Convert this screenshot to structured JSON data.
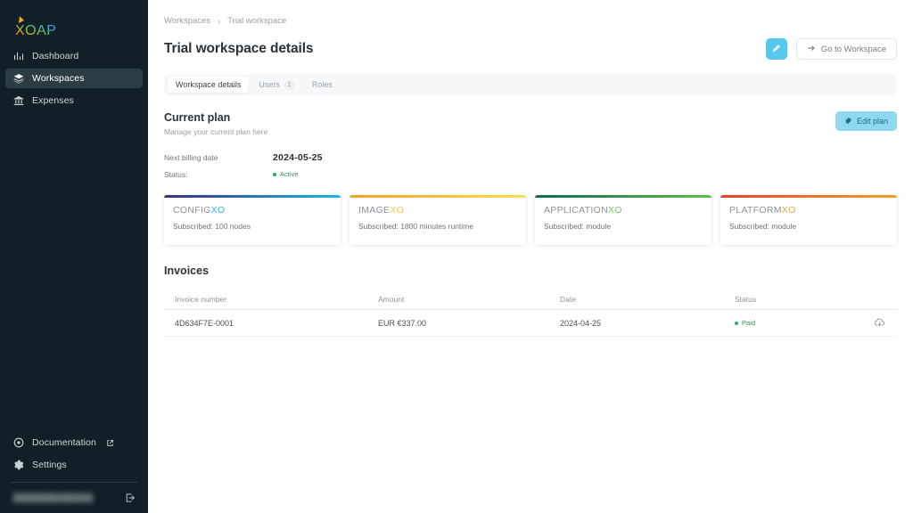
{
  "brand": {
    "name": "XOAP"
  },
  "sidebar": {
    "items": [
      {
        "label": "Dashboard",
        "icon": "chart-bar-icon",
        "active": false
      },
      {
        "label": "Workspaces",
        "icon": "layers-icon",
        "active": true
      },
      {
        "label": "Expenses",
        "icon": "bank-icon",
        "active": false
      }
    ],
    "bottom": [
      {
        "label": "Documentation",
        "icon": "info-circle-icon",
        "external": true
      },
      {
        "label": "Settings",
        "icon": "gear-icon",
        "external": false
      }
    ],
    "user_email": "redacted@email.com",
    "logout_icon": "logout-icon"
  },
  "breadcrumb": {
    "root": "Workspaces",
    "separator": "›",
    "current": "Trial workspace"
  },
  "header": {
    "title": "Trial workspace details",
    "edit_icon": "pencil-icon",
    "go_to_workspace_label": "Go to Workspace",
    "go_to_workspace_icon": "arrow-right-icon"
  },
  "tabs": [
    {
      "label": "Workspace details",
      "badge": "",
      "active": true
    },
    {
      "label": "Users",
      "badge": "1",
      "active": false
    },
    {
      "label": "Roles",
      "badge": "",
      "active": false
    }
  ],
  "current_plan": {
    "title": "Current plan",
    "subtitle": "Manage your current plan here",
    "edit_button_label": "Edit plan",
    "edit_button_icon": "gear-icon",
    "next_billing_label": "Next billing date",
    "next_billing_value": "2024-05-25",
    "status_label": "Status:",
    "status_value": "Active",
    "status_color": "#27ae60"
  },
  "products": [
    {
      "name_main": "CONFIG",
      "name_suffix": "XO",
      "subscribed": "Subscribed: 100 nodes",
      "bar_from": "#3b2f87",
      "bar_to": "#18b6e9",
      "suffix_color": "#2fb4e0"
    },
    {
      "name_main": "IMAGE",
      "name_suffix": "XO",
      "subscribed": "Subscribed: 1800 minutes runtime",
      "bar_from": "#f4a02a",
      "bar_to": "#f5de52",
      "suffix_color": "#f2c948"
    },
    {
      "name_main": "APPLICATION",
      "name_suffix": "XO",
      "subscribed": "Subscribed: module",
      "bar_from": "#0e6b52",
      "bar_to": "#66bb4a",
      "suffix_color": "#7bbf6a"
    },
    {
      "name_main": "PLATFORM",
      "name_suffix": "XO",
      "subscribed": "Subscribed: module",
      "bar_from": "#e0452e",
      "bar_to": "#f0a12c",
      "suffix_color": "#efa43a"
    }
  ],
  "invoices": {
    "title": "Invoices",
    "columns": [
      "Invoice number",
      "Amount",
      "Date",
      "Status",
      ""
    ],
    "rows": [
      {
        "number": "4D634F7E-0001",
        "amount": "EUR €337.00",
        "date": "2024-04-25",
        "status": "Paid",
        "status_color": "#27ae60",
        "download_icon": "cloud-download-icon"
      }
    ]
  }
}
